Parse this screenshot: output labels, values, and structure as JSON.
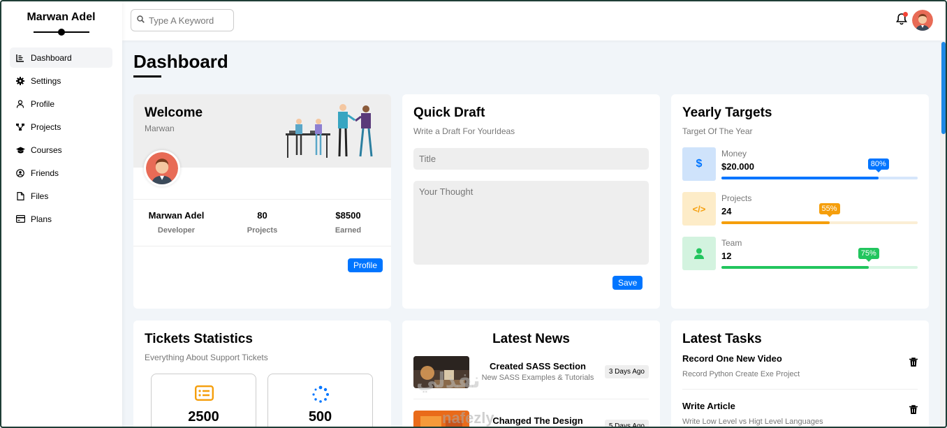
{
  "brand": "Marwan Adel",
  "sidebar": {
    "items": [
      {
        "label": "Dashboard",
        "icon": "chart-line-icon"
      },
      {
        "label": "Settings",
        "icon": "gear-icon"
      },
      {
        "label": "Profile",
        "icon": "user-icon"
      },
      {
        "label": "Projects",
        "icon": "diagram-icon"
      },
      {
        "label": "Courses",
        "icon": "graduation-cap-icon"
      },
      {
        "label": "Friends",
        "icon": "user-circle-icon"
      },
      {
        "label": "Files",
        "icon": "file-icon"
      },
      {
        "label": "Plans",
        "icon": "credit-card-icon"
      }
    ]
  },
  "topbar": {
    "search_placeholder": "Type A Keyword"
  },
  "page": {
    "title": "Dashboard"
  },
  "welcome": {
    "title": "Welcome",
    "name": "Marwan",
    "stats": [
      {
        "value": "Marwan Adel",
        "label": "Developer"
      },
      {
        "value": "80",
        "label": "Projects"
      },
      {
        "value": "$8500",
        "label": "Earned"
      }
    ],
    "button": "Profile"
  },
  "draft": {
    "title": "Quick Draft",
    "subtitle": "Write a Draft For YourIdeas",
    "title_placeholder": "Title",
    "body_placeholder": "Your Thought",
    "button": "Save"
  },
  "targets": {
    "title": "Yearly Targets",
    "subtitle": "Target Of The Year",
    "items": [
      {
        "label": "Money",
        "value": "$20.000",
        "percent": 80,
        "percent_label": "80%",
        "color": "#0075ff",
        "bg": "#cfe3fb",
        "track": "#d6e6fb",
        "icon": "dollar-icon",
        "glyph": "$"
      },
      {
        "label": "Projects",
        "value": "24",
        "percent": 55,
        "percent_label": "55%",
        "color": "#f59e0b",
        "bg": "#fdecc8",
        "track": "#fbeed5",
        "icon": "code-icon",
        "glyph": "</>"
      },
      {
        "label": "Team",
        "value": "12",
        "percent": 75,
        "percent_label": "75%",
        "color": "#22c55e",
        "bg": "#d3f3df",
        "track": "#d9f5e4",
        "icon": "user-icon",
        "glyph": ""
      }
    ]
  },
  "tickets": {
    "title": "Tickets Statistics",
    "subtitle": "Everything About Support Tickets",
    "items": [
      {
        "value": "2500",
        "icon": "list-icon",
        "color": "#f59e0b"
      },
      {
        "value": "500",
        "icon": "spinner-icon",
        "color": "#0075ff"
      }
    ]
  },
  "news": {
    "title": "Latest News",
    "items": [
      {
        "title": "Created SASS Section",
        "desc": "New SASS Examples & Tutorials",
        "date": "3 Days Ago"
      },
      {
        "title": "Changed The Design",
        "desc": "",
        "date": "5 Days Ago"
      }
    ]
  },
  "tasks": {
    "title": "Latest Tasks",
    "items": [
      {
        "title": "Record One New Video",
        "desc": "Record Python Create Exe Project"
      },
      {
        "title": "Write Article",
        "desc": "Write Low Level vs Higt Level Languages"
      }
    ]
  },
  "watermark": {
    "arabic": "نفذلي",
    "latin": "nafezly"
  }
}
